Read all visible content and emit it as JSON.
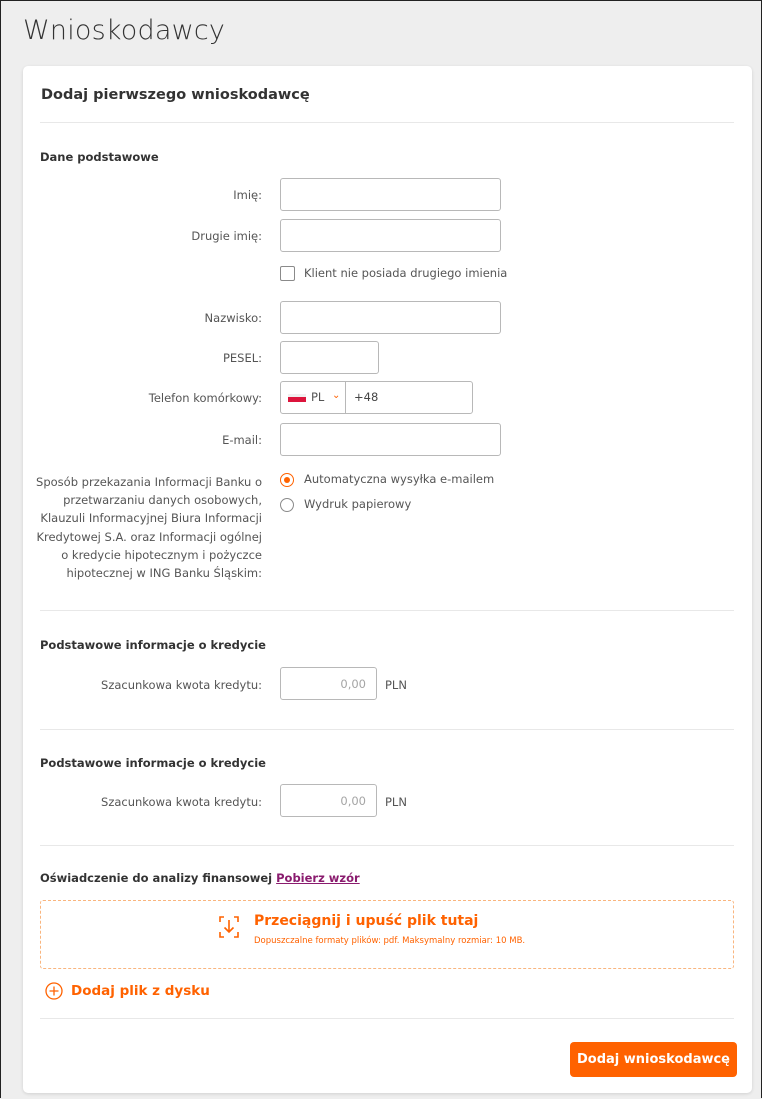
{
  "page": {
    "title": "Wnioskodawcy"
  },
  "card": {
    "title": "Dodaj pierwszego wnioskodawcę",
    "basic": {
      "heading": "Dane podstawowe",
      "first_name_label": "Imię:",
      "second_name_label": "Drugie imię:",
      "no_second_name_label": "Klient nie posiada drugiego imienia",
      "no_second_name_checked": false,
      "last_name_label": "Nazwisko:",
      "pesel_label": "PESEL:",
      "phone_label": "Telefon komórkowy:",
      "phone_country": "PL",
      "phone_prefix": "+48",
      "email_label": "E-mail:",
      "delivery_label": "Sposób przekazania Informacji Banku o przetwarzaniu danych osobowych, Klauzuli Informacyjnej Biura Informacji Kredytowej S.A. oraz Informacji ogólnej o kredycie hipotecznym i pożyczce hipotecznej w ING Banku Śląskim:",
      "delivery_options": [
        {
          "label": "Automatyczna wysyłka e-mailem",
          "checked": true
        },
        {
          "label": "Wydruk papierowy",
          "checked": false
        }
      ]
    },
    "credit_sections": [
      {
        "heading": "Podstawowe informacje o kredycie",
        "amount_label": "Szacunkowa kwota kredytu:",
        "amount_value": "0,00",
        "currency": "PLN"
      },
      {
        "heading": "Podstawowe informacje o kredycie",
        "amount_label": "Szacunkowa kwota kredytu:",
        "amount_value": "0,00",
        "currency": "PLN"
      }
    ],
    "statement": {
      "label": "Oświadczenie do analizy finansowej",
      "link": "Pobierz wzór"
    },
    "dropzone": {
      "title": "Przeciągnij i upuść plik tutaj",
      "subtitle": "Dopuszczalne formaty plików: pdf. Maksymalny rozmiar: 10 MB."
    },
    "add_file_label": "Dodaj plik z dysku",
    "submit_label": "Dodaj wnioskodawcę"
  },
  "colors": {
    "accent": "#ff6200",
    "link": "#8a1b6e",
    "page_bg": "#eeeeee"
  },
  "icons": {
    "upload": "upload-arrow-icon",
    "add": "plus-circle-icon",
    "chevron": "chevron-down-icon",
    "flag": "poland-flag-icon"
  }
}
